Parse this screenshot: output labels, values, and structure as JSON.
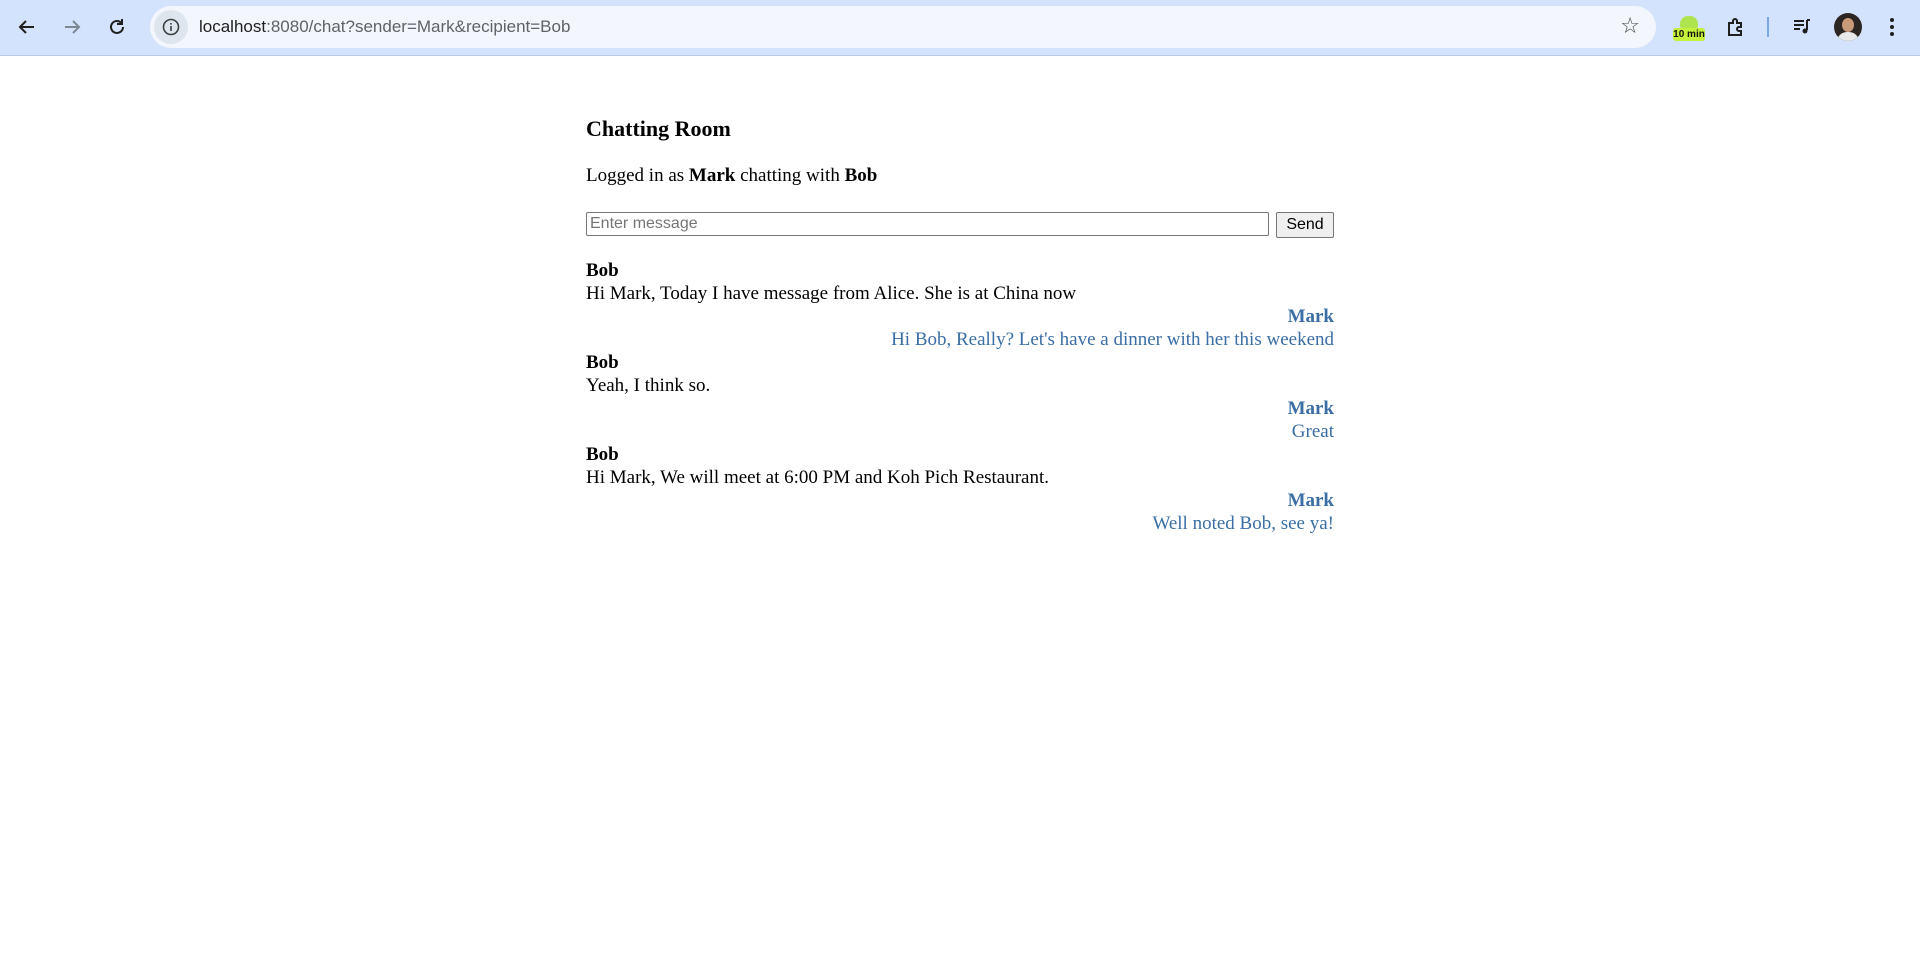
{
  "browser": {
    "url_host": "localhost",
    "url_rest": ":8080/chat?sender=Mark&recipient=Bob",
    "timer_badge": "10 min"
  },
  "page": {
    "title": "Chatting Room",
    "login_prefix": "Logged in as ",
    "sender": "Mark",
    "login_middle": " chatting with ",
    "recipient": "Bob"
  },
  "compose": {
    "placeholder": "Enter message",
    "value": "",
    "send_label": "Send"
  },
  "messages": [
    {
      "from": "Bob",
      "text": "Hi Mark, Today I have message from Alice. She is at China now",
      "direction": "incoming"
    },
    {
      "from": "Mark",
      "text": "Hi Bob, Really? Let's have a dinner with her this weekend",
      "direction": "outgoing"
    },
    {
      "from": "Bob",
      "text": "Yeah, I think so.",
      "direction": "incoming"
    },
    {
      "from": "Mark",
      "text": "Great",
      "direction": "outgoing"
    },
    {
      "from": "Bob",
      "text": "Hi Mark, We will meet at 6:00 PM and Koh Pich Restaurant.",
      "direction": "incoming"
    },
    {
      "from": "Mark",
      "text": "Well noted Bob, see ya!",
      "direction": "outgoing"
    }
  ],
  "colors": {
    "chrome_bg": "#d3e3fd",
    "outgoing_text": "#3a6ea5",
    "incoming_text": "#000000"
  }
}
